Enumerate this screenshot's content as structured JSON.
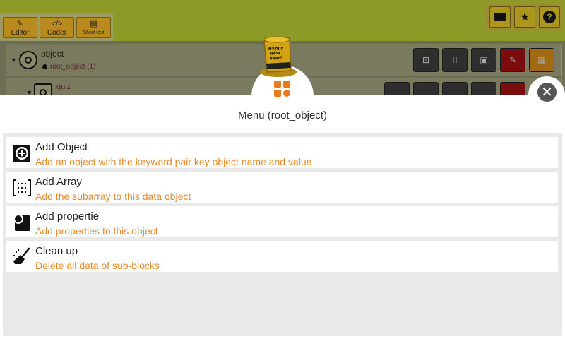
{
  "toolbar": {
    "tabs": [
      {
        "label": "Editor",
        "icon": "edit-icon"
      },
      {
        "label": "Coder",
        "icon": "code-icon"
      },
      {
        "label": "Short text",
        "icon": "document-icon"
      }
    ],
    "right_buttons": [
      {
        "icon": "terminal-icon"
      },
      {
        "icon": "star-icon"
      },
      {
        "icon": "help-icon",
        "glyph": "?"
      }
    ]
  },
  "tree": {
    "root": {
      "title": "object",
      "subtitle": "root_object  (1)"
    },
    "child": {
      "title": "quiz"
    }
  },
  "menu": {
    "title": "Menu (root_object)",
    "items": [
      {
        "title": "Add Object",
        "description": "Add an object with the keyword pair key object name and value",
        "icon": "add-object-icon"
      },
      {
        "title": "Add Array",
        "description": "Add the subarray to this data object",
        "icon": "array-icon"
      },
      {
        "title": "Add propertie",
        "description": "Add properties to this object",
        "icon": "properties-icon"
      },
      {
        "title": "Clean up",
        "description": "Delete all data of sub-blocks",
        "icon": "broom-icon"
      }
    ]
  },
  "colors": {
    "accent_orange": "#e87a1e",
    "description_orange": "#e88a2c",
    "app_olive": "#8e9a27"
  }
}
